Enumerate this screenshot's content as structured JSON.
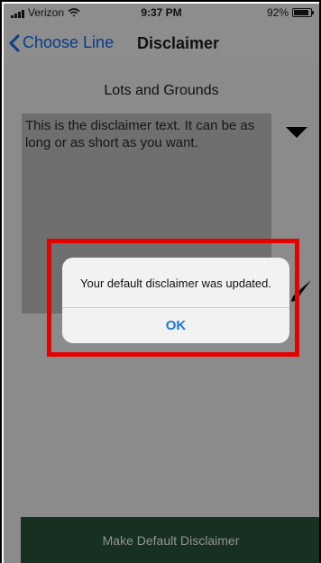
{
  "status_bar": {
    "carrier": "Verizon",
    "time": "9:37 PM",
    "battery_percent": "92%",
    "signal_icon": "signal-bars-icon",
    "wifi_icon": "wifi-icon",
    "battery_icon": "battery-icon"
  },
  "nav": {
    "back_label": "Choose Line",
    "title": "Disclaimer",
    "back_icon": "chevron-left-icon"
  },
  "content": {
    "subtitle": "Lots and Grounds",
    "disclaimer_text": "This is the disclaimer text. It can be as long or as short as you want.",
    "dropdown_icon": "triangle-down-icon",
    "edit_icon": "pen-icon",
    "default_button_label": "Make Default Disclaimer"
  },
  "alert": {
    "message": "Your default disclaimer was updated.",
    "ok_label": "OK"
  },
  "colors": {
    "accent": "#1a75e8",
    "nav_link": "#0a3c8a",
    "default_button": "#183022",
    "highlight": "#e60000"
  }
}
